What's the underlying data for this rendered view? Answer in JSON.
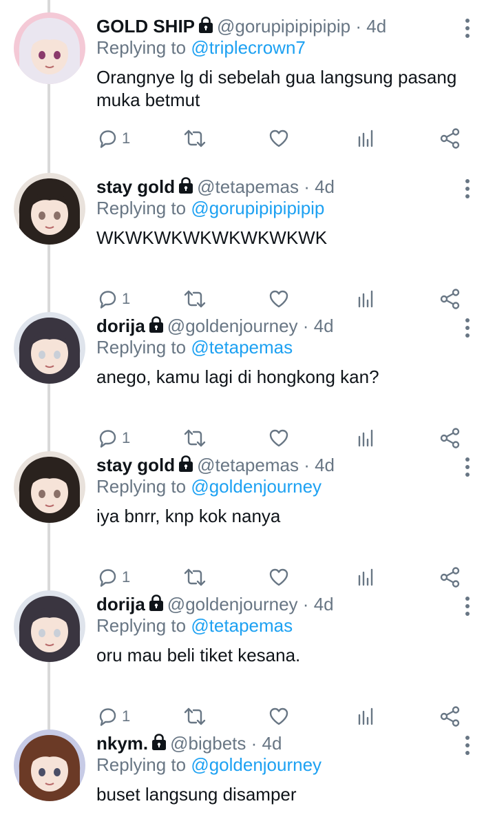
{
  "tweets": [
    {
      "name": "GOLD SHIP",
      "handle": "@gorupipipipipip",
      "sep": "·",
      "time": "4d",
      "replying_label": "Replying to",
      "replying_to": "@triplecrown7",
      "text": "Orangnye lg di sebelah gua langsung pasang muka betmut",
      "reply_count": "1",
      "avatar_palette": {
        "bg": "#f4c9d6",
        "hair": "#eae6f0",
        "accent": "#8a3a6b"
      }
    },
    {
      "name": "stay gold",
      "handle": "@tetapemas",
      "sep": "·",
      "time": "4d",
      "replying_label": "Replying to",
      "replying_to": "@gorupipipipipip",
      "text": "WKWKWKWKWKWKWKWK",
      "reply_count": "1",
      "avatar_palette": {
        "bg": "#e9e2dc",
        "hair": "#2a221e",
        "accent": "#8a7068"
      }
    },
    {
      "name": "dorija",
      "handle": "@goldenjourney",
      "sep": "·",
      "time": "4d",
      "replying_label": "Replying to",
      "replying_to": "@tetapemas",
      "text": "anego, kamu lagi di hongkong kan?",
      "reply_count": "1",
      "avatar_palette": {
        "bg": "#dfe4ec",
        "hair": "#3a3540",
        "accent": "#c9cfd8"
      }
    },
    {
      "name": "stay gold",
      "handle": "@tetapemas",
      "sep": "·",
      "time": "4d",
      "replying_label": "Replying to",
      "replying_to": "@goldenjourney",
      "text": "iya bnrr, knp kok nanya",
      "reply_count": "1",
      "avatar_palette": {
        "bg": "#e9e2dc",
        "hair": "#2a221e",
        "accent": "#8a7068"
      }
    },
    {
      "name": "dorija",
      "handle": "@goldenjourney",
      "sep": "·",
      "time": "4d",
      "replying_label": "Replying to",
      "replying_to": "@tetapemas",
      "text": "oru mau beli tiket kesana.",
      "reply_count": "1",
      "avatar_palette": {
        "bg": "#dfe4ec",
        "hair": "#3a3540",
        "accent": "#c9cfd8"
      }
    },
    {
      "name": "nkym.",
      "handle": "@bigbets",
      "sep": "·",
      "time": "4d",
      "replying_label": "Replying to",
      "replying_to": "@goldenjourney",
      "text": "buset langsung disamper",
      "avatar_palette": {
        "bg": "#c7cbe6",
        "hair": "#6b3a26",
        "accent": "#4a4e66"
      }
    }
  ],
  "icons": {
    "reply": "reply-icon",
    "retweet": "retweet-icon",
    "like": "heart-icon",
    "analytics": "analytics-icon",
    "share": "share-icon",
    "more": "more-vertical-icon",
    "protected": "lock-icon"
  },
  "colors": {
    "link": "#1da1f2",
    "secondary_text": "#687684",
    "primary_text": "#0f1419",
    "thread_line": "#d9d9d9"
  }
}
